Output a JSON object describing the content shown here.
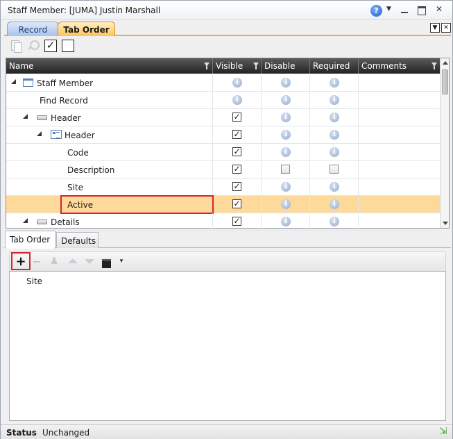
{
  "window": {
    "title": "Staff Member: [JUMA] Justin Marshall",
    "help_icon": "help-icon",
    "help_glyph": "?"
  },
  "top_tabs": [
    {
      "label": "Record",
      "active": false
    },
    {
      "label": "Tab Order",
      "active": true
    }
  ],
  "toolbar": {
    "check_glyph": "✓"
  },
  "grid": {
    "columns": [
      "Name",
      "Visible",
      "Disable",
      "Required",
      "Comments"
    ],
    "info_glyph": "i",
    "check_glyph": "✓",
    "rows": [
      {
        "label": "Staff Member",
        "icon": "form-icon",
        "expanded": true,
        "visible": "info",
        "disable": "info",
        "required": "info"
      },
      {
        "label": "Find Record",
        "icon": "",
        "expanded": false,
        "visible": "info",
        "disable": "info",
        "required": "info"
      },
      {
        "label": "Header",
        "icon": "header-icon",
        "expanded": true,
        "visible": "checked",
        "disable": "info",
        "required": "info"
      },
      {
        "label": "Header",
        "icon": "header-panel-icon",
        "expanded": true,
        "visible": "checked",
        "disable": "info",
        "required": "info"
      },
      {
        "label": "Code",
        "icon": "",
        "expanded": false,
        "visible": "checked",
        "disable": "info",
        "required": "info"
      },
      {
        "label": "Description",
        "icon": "",
        "expanded": false,
        "visible": "checked",
        "disable": "unchecked",
        "required": "unchecked"
      },
      {
        "label": "Site",
        "icon": "",
        "expanded": false,
        "visible": "checked",
        "disable": "info",
        "required": "info"
      },
      {
        "label": "Active",
        "icon": "",
        "expanded": false,
        "visible": "checked",
        "disable": "info",
        "required": "info",
        "selected": true
      },
      {
        "label": "Details",
        "icon": "header-icon",
        "expanded": true,
        "visible": "checked",
        "disable": "info",
        "required": "info"
      }
    ]
  },
  "bottom_tabs": [
    {
      "label": "Tab Order",
      "active": true
    },
    {
      "label": "Defaults",
      "active": false
    }
  ],
  "bottom_toolbar": {
    "add_glyph": "+",
    "remove_glyph": "−",
    "caret_glyph": "▾"
  },
  "tab_order_list": [
    "Site"
  ],
  "status": {
    "label": "Status",
    "value": "Unchanged"
  },
  "colors": {
    "accent_orange": "#f6a93b",
    "selected_row": "#fdd99a",
    "highlight_red": "#d6252c"
  }
}
